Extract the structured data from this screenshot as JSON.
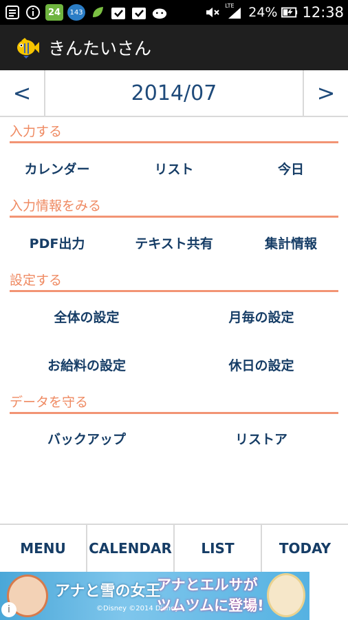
{
  "status_bar": {
    "notification_badge_green": "24",
    "notification_badge_blue": "143",
    "network_label": "LTE",
    "battery": "24%",
    "time": "12:38"
  },
  "app": {
    "title": "きんたいさん"
  },
  "month_nav": {
    "prev": "<",
    "month": "2014/07",
    "next": ">"
  },
  "sections": {
    "input": {
      "heading": "入力する",
      "calendar": "カレンダー",
      "list": "リスト",
      "today": "今日"
    },
    "view": {
      "heading": "入力情報をみる",
      "pdf": "PDF出力",
      "text_share": "テキスト共有",
      "stats": "集計情報"
    },
    "settings": {
      "heading": "設定する",
      "general": "全体の設定",
      "monthly": "月毎の設定",
      "salary": "お給料の設定",
      "holiday": "休日の設定"
    },
    "protect": {
      "heading": "データを守る",
      "backup": "バックアップ",
      "restore": "リストア"
    }
  },
  "tabs": {
    "menu": "MENU",
    "calendar": "CALENDAR",
    "list": "LIST",
    "today": "TODAY"
  },
  "ad": {
    "title": "アナと雪の女王",
    "small": "©Disney ©2014 Disney",
    "line1": "アナとエルサが",
    "line2": "ツムツムに登場!",
    "info": "i"
  },
  "colors": {
    "accent": "#ef8a62",
    "link": "#163d66",
    "title_bar": "#1f1f1f"
  }
}
